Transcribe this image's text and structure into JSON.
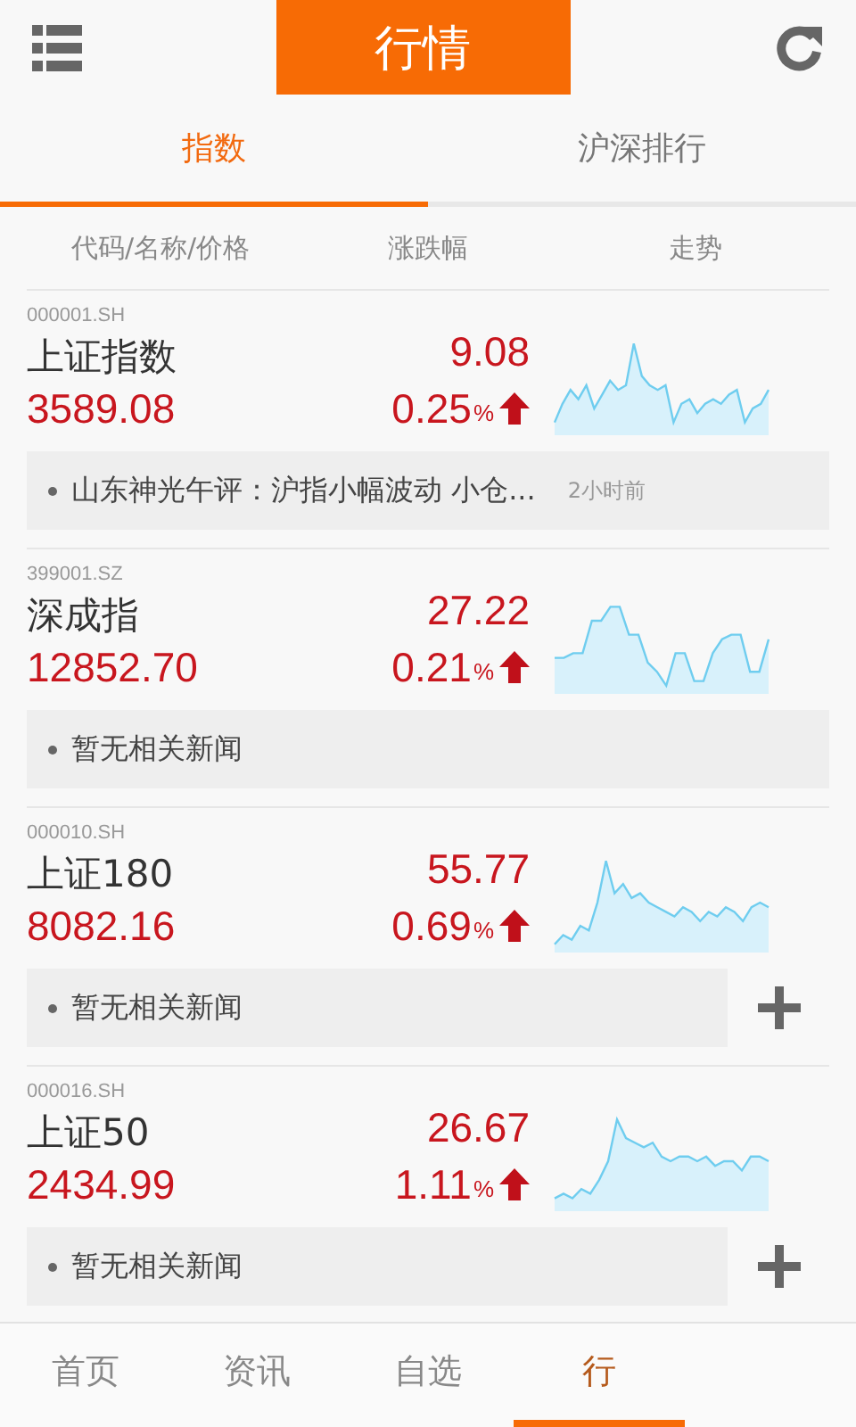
{
  "header": {
    "title": "行情"
  },
  "tabs": [
    {
      "label": "指数",
      "selected": true
    },
    {
      "label": "沪深排行",
      "selected": false
    }
  ],
  "columns": [
    "代码/名称/价格",
    "涨跌幅",
    "走势"
  ],
  "indices": [
    {
      "code": "000001.SH",
      "name": "上证指数",
      "price": "3589.08",
      "change": "9.08",
      "percent": "0.25",
      "percent_sign": "%",
      "news": "山东神光午评：沪指小幅波动 小仓...",
      "news_time": "2小时前",
      "show_add": false
    },
    {
      "code": "399001.SZ",
      "name": "深成指",
      "price": "12852.70",
      "change": "27.22",
      "percent": "0.21",
      "percent_sign": "%",
      "news": "暂无相关新闻",
      "show_add": false
    },
    {
      "code": "000010.SH",
      "name": "上证180",
      "price": "8082.16",
      "change": "55.77",
      "percent": "0.69",
      "percent_sign": "%",
      "news": "暂无相关新闻",
      "show_add": true
    },
    {
      "code": "000016.SH",
      "name": "上证50",
      "price": "2434.99",
      "change": "26.67",
      "percent": "1.11",
      "percent_sign": "%",
      "news": "暂无相关新闻",
      "show_add": true
    }
  ],
  "bottom_nav": [
    {
      "label": "首页",
      "selected": false
    },
    {
      "label": "资讯",
      "selected": false
    },
    {
      "label": "自选",
      "selected": false
    },
    {
      "label": "行",
      "selected": true
    }
  ]
}
